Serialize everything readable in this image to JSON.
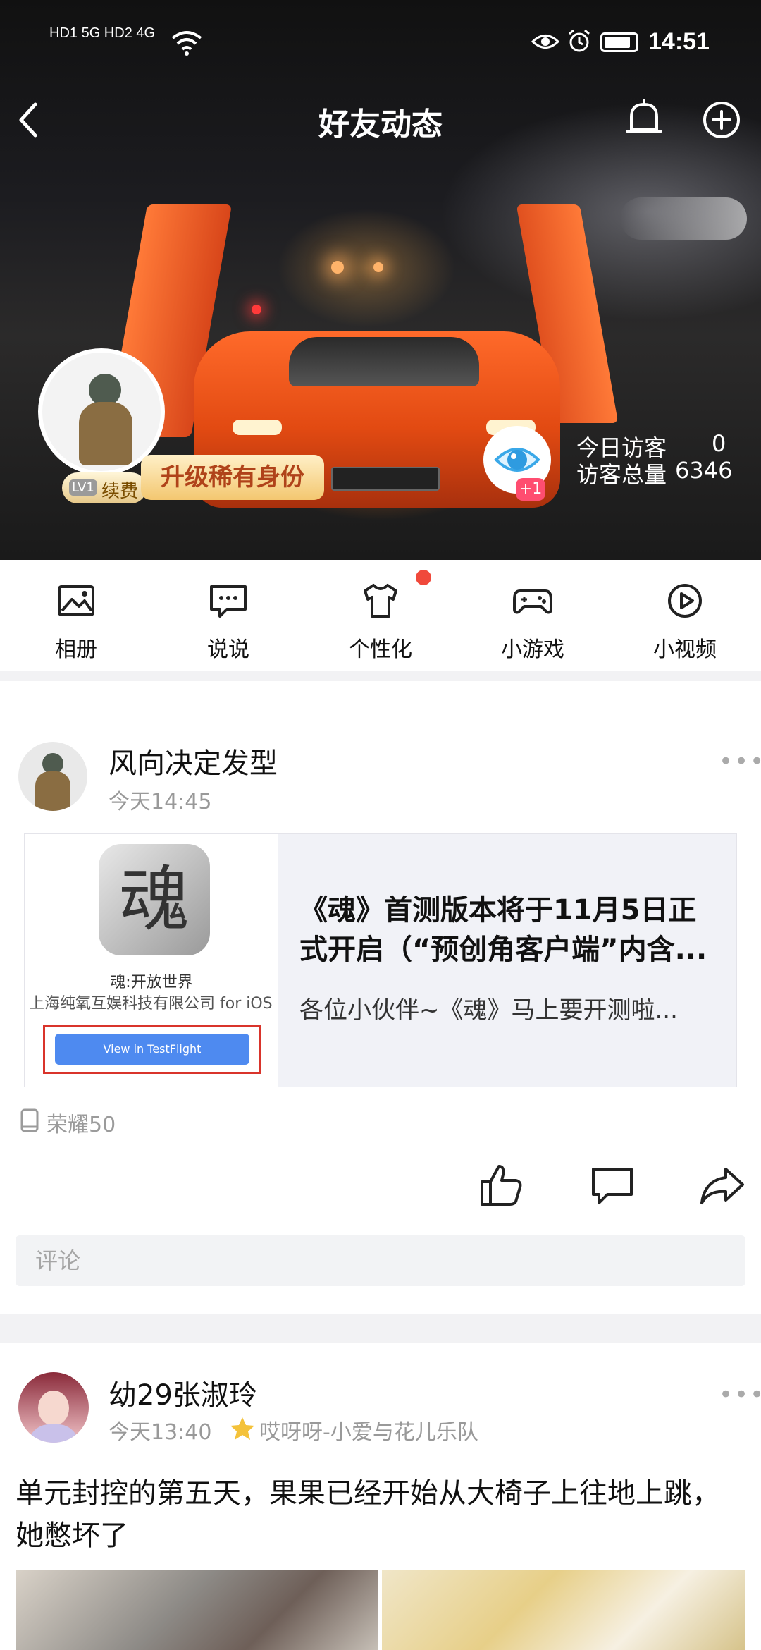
{
  "status_bar": {
    "network_left": "HD1 5G  HD2 4G",
    "time": "14:51"
  },
  "nav": {
    "title": "好友动态",
    "back_icon": "back-arrow-icon",
    "bell_icon": "bell-icon",
    "add_icon": "plus-circle-icon"
  },
  "profile": {
    "badge_level": "LV1",
    "badge_renew": "续费",
    "upgrade_label": "升级稀有身份",
    "eye_badge": "+1",
    "today_visits_label": "今日访客",
    "today_visits_value": "0",
    "total_visits_label": "访客总量",
    "total_visits_value": "6346"
  },
  "features": [
    {
      "label": "相册",
      "icon": "photo-album-icon"
    },
    {
      "label": "说说",
      "icon": "chat-bubble-icon"
    },
    {
      "label": "个性化",
      "icon": "tshirt-icon"
    },
    {
      "label": "小游戏",
      "icon": "gamepad-icon"
    },
    {
      "label": "小视频",
      "icon": "play-circle-icon"
    }
  ],
  "post1": {
    "author": "风向决定发型",
    "time": "今天14:45",
    "share": {
      "app_glyph": "魂",
      "app_name": "魂:开放世界",
      "app_company": "上海纯氧互娱科技有限公司 for iOS",
      "testflight_button": "View in TestFlight",
      "title": "《魂》首测版本将于11月5日正式开启（“预创角客户端”内含...",
      "desc": "各位小伙伴~《魂》马上要开测啦..."
    },
    "device": "荣耀50",
    "comment_placeholder": "评论"
  },
  "post2": {
    "author": "幼29张淑玲",
    "time": "今天13:40",
    "tag": "哎呀呀-小爱与花儿乐队",
    "text": "单元封控的第五天，果果已经开始从大椅子上往地上跳，她憋坏了"
  }
}
